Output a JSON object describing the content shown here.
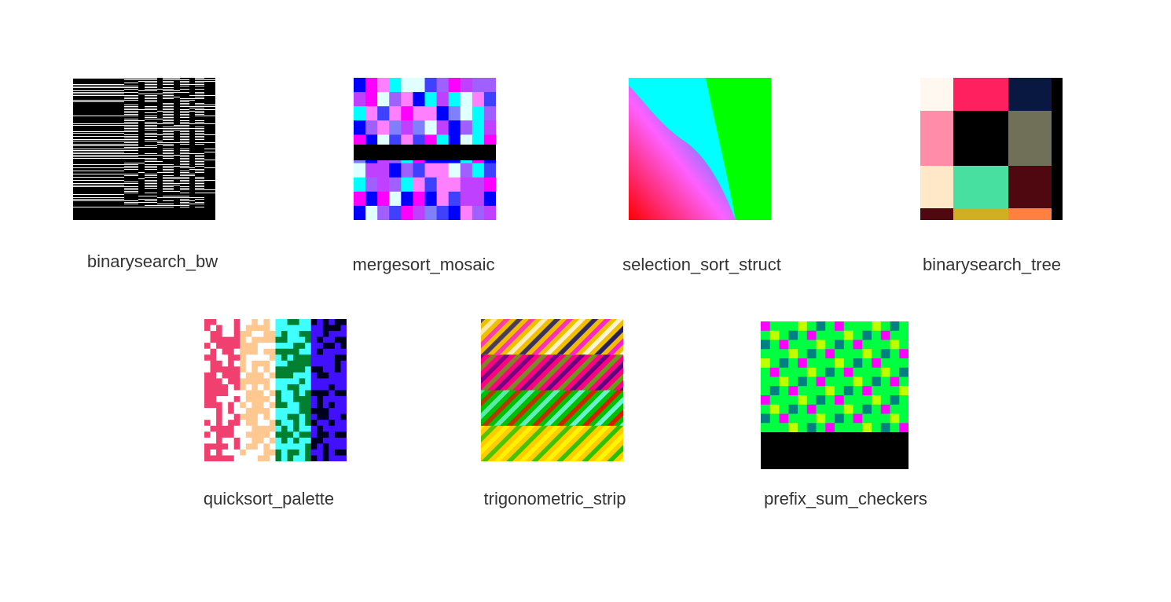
{
  "gallery": {
    "items": [
      {
        "id": "binarysearch_bw",
        "label": "binarysearch_bw"
      },
      {
        "id": "mergesort_mosaic",
        "label": "mergesort_mosaic"
      },
      {
        "id": "selection_sort_struct",
        "label": "selection_sort_struct"
      },
      {
        "id": "binarysearch_tree",
        "label": "binarysearch_tree"
      },
      {
        "id": "quicksort_palette",
        "label": "quicksort_palette"
      },
      {
        "id": "trigonometric_strip",
        "label": "trigonometric_strip"
      },
      {
        "id": "prefix_sum_checkers",
        "label": "prefix_sum_checkers"
      }
    ]
  },
  "colors": {
    "mosaic": [
      "#ff00ff",
      "#0000ff",
      "#00ffff",
      "#8080ff",
      "#c040ff",
      "#4040ff",
      "#ff80ff",
      "#e0ffff",
      "#a060ff"
    ],
    "tree": [
      "#fff8f0",
      "#ff2060",
      "#081840",
      "#ff8ca8",
      "#000000",
      "#707058",
      "#ffe8c8",
      "#48e0a0",
      "#500810",
      "#500810",
      "#d0b020",
      "#ff8040"
    ],
    "palette": [
      "#f04070",
      "#ffc890",
      "#008030",
      "#40ffff",
      "#4010ff",
      "#000020"
    ],
    "strip_bands": [
      [
        "#f0c000",
        "#000080",
        "#ff00ff",
        "#ffffff"
      ],
      [
        "#ff0080",
        "#40c000",
        "#400080"
      ],
      [
        "#00c000",
        "#ff0000",
        "#80ffff"
      ],
      [
        "#ffcc00",
        "#00c000",
        "#ffff00"
      ]
    ],
    "checkers": [
      "#ff00ff",
      "#80ff00",
      "#00ff40",
      "#0080ff",
      "#c0ff00",
      "#ff8080",
      "#008080",
      "#ff00c0"
    ]
  }
}
